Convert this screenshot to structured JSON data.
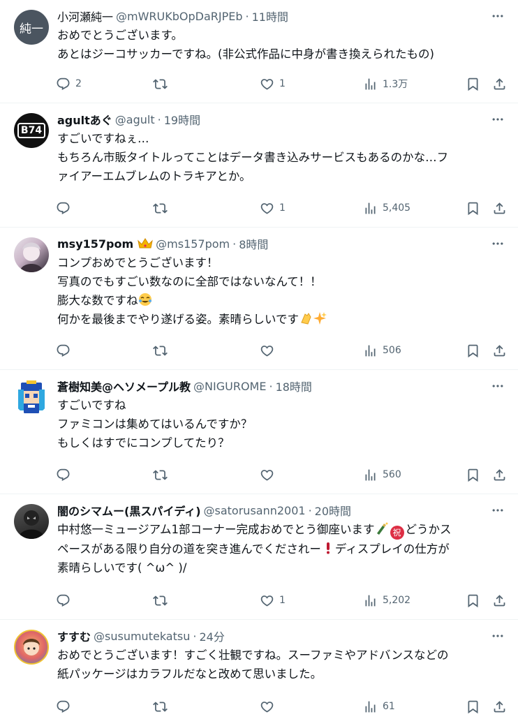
{
  "tweets": [
    {
      "name": "小河瀬純一",
      "handle": "@mWRUKbOpDaRJPEb",
      "sep": "·",
      "time": "11時間",
      "avatar_text": "純一",
      "lines": [
        "おめでとうございます。",
        "あとはジーコサッカーですね。(非公式作品に中身が書き換えられたもの)"
      ],
      "replies": "2",
      "retweets": "",
      "likes": "1",
      "views": "1.3万"
    },
    {
      "name": "agultあぐ",
      "handle": "@agult",
      "sep": "·",
      "time": "19時間",
      "avatar_text": "B74",
      "lines": [
        "すごいですねぇ…",
        "もちろん市販タイトルってことはデータ書き込みサービスもあるのかな…フ",
        "ァイアーエムブレムのトラキアとか。"
      ],
      "replies": "",
      "retweets": "",
      "likes": "1",
      "views": "5,405"
    },
    {
      "name": "msy157pom",
      "handle": "@ms157pom",
      "sep": "·",
      "time": "8時間",
      "lines": [
        "コンプおめでとうございます！",
        "写真のでもすごい数なのに全部ではないなんて！！",
        "膨大な数ですね",
        "何かを最後までやり遂げる姿。素晴らしいです"
      ],
      "replies": "",
      "retweets": "",
      "likes": "",
      "views": "506"
    },
    {
      "name": "蒼樹知美@ヘソメープル教",
      "handle": "@NIGUROME",
      "sep": "·",
      "time": "18時間",
      "lines": [
        "すごいですね",
        "ファミコンは集めてはいるんですか？",
        "もしくはすでにコンプしてたり？"
      ],
      "replies": "",
      "retweets": "",
      "likes": "",
      "views": "560"
    },
    {
      "name": "闇のシマムー(黒スパイディ)",
      "handle": "@satorusann2001",
      "sep": "·",
      "time": "20時間",
      "lines": [
        "中村悠一ミュージアム1部コーナー完成おめでとう御座います",
        "どうかス",
        "ペースがある限り自分の道を突き進んでくだされー",
        "ディスプレイの仕方が",
        "素晴らしいです( ^ω^ )/"
      ],
      "iwai": "祝",
      "replies": "",
      "retweets": "",
      "likes": "1",
      "views": "5,202"
    },
    {
      "name": "すすむ",
      "handle": "@susumutekatsu",
      "sep": "·",
      "time": "24分",
      "lines": [
        "おめでとうございます！すごく壮観ですね。スーファミやアドバンスなどの",
        "紙パッケージはカラフルだなと改めて思いました。"
      ],
      "replies": "",
      "retweets": "",
      "likes": "",
      "views": "61"
    }
  ],
  "colors": {
    "text": "#0f1419",
    "muted": "#536471",
    "divider": "#eff3f4"
  }
}
